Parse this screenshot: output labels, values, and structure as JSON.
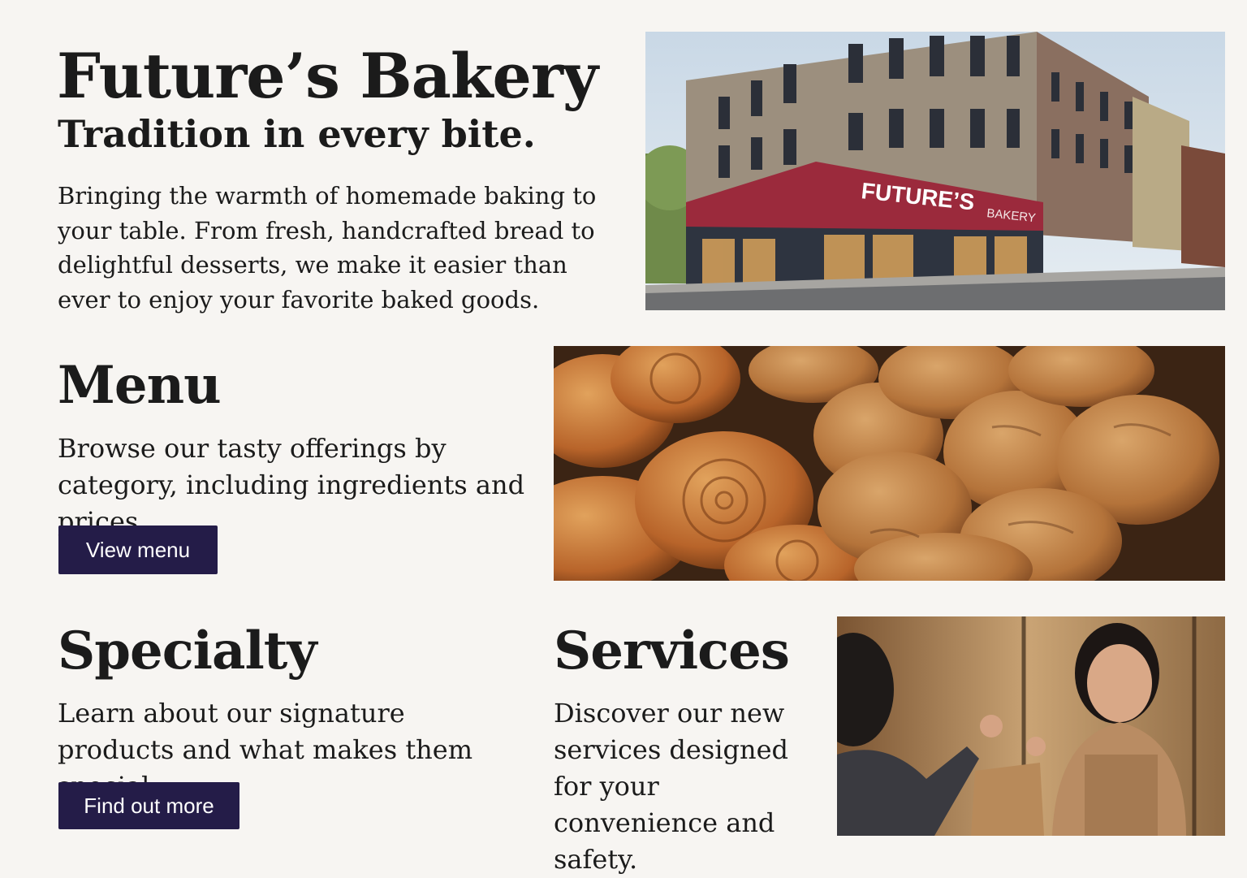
{
  "hero": {
    "title": "Future’s Bakery",
    "tagline": "Tradition in every bite.",
    "intro": "Bringing the warmth of homemade baking to your table. From fresh, handcrafted bread to delightful desserts, we make it easier than ever to enjoy your favorite baked goods."
  },
  "storefront": {
    "sign_main": "FUTURE’S",
    "sign_sub": "BAKERY"
  },
  "menu": {
    "title": "Menu",
    "text": "Browse our tasty offerings by category, including ingredients and prices.",
    "button": "View menu"
  },
  "specialty": {
    "title": "Specialty",
    "text": "Learn about our signature products and what makes them special.",
    "button": "Find out more"
  },
  "services": {
    "title": "Services",
    "text": "Discover our new services designed for your convenience and safety."
  },
  "colors": {
    "background": "#f7f5f2",
    "button": "#241c48",
    "awning": "#9b2a3c"
  },
  "images": {
    "storefront": "bakery-storefront-photo",
    "bread": "bread-and-pastries-photo",
    "service": "customer-service-photo"
  }
}
